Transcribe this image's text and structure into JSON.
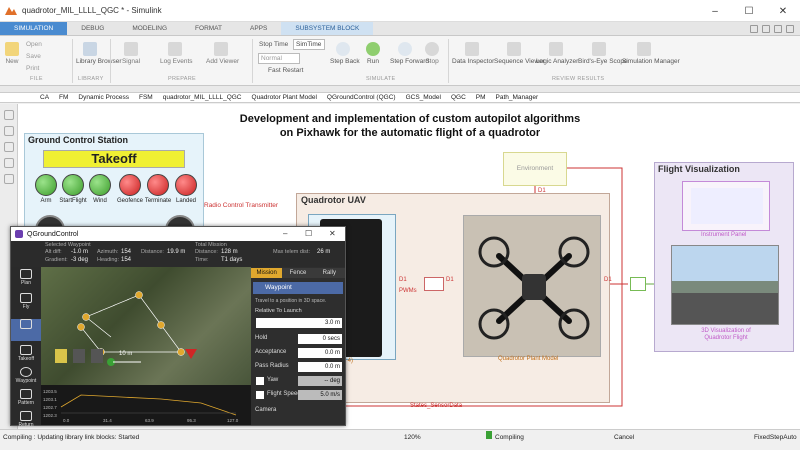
{
  "window": {
    "title": "quadrotor_MIL_LLLL_QGC * - Simulink"
  },
  "ribbon_tabs": [
    "SIMULATION",
    "DEBUG",
    "MODELING",
    "FORMAT",
    "APPS",
    "SUBSYSTEM BLOCK"
  ],
  "ribbon": {
    "file": {
      "open": "Open",
      "save": "Save",
      "print": "Print",
      "new": "New",
      "section": "FILE"
    },
    "library": {
      "label": "Library Browser",
      "section": "LIBRARY"
    },
    "prepare": {
      "signal": "Signal",
      "log": "Log Events",
      "add_viewer": "Add Viewer",
      "section": "PREPARE"
    },
    "simulate": {
      "stop_time_label": "Stop Time",
      "stop_time_value": "SimTime",
      "mode": "Normal",
      "fast_restart": "Fast Restart",
      "step_back": "Step Back",
      "run": "Run",
      "step_forward": "Step Forward",
      "stop": "Stop",
      "section": "SIMULATE"
    },
    "review": {
      "items": [
        "Data Inspector",
        "Sequence Viewer",
        "Logic Analyzer",
        "Bird's-Eye Scope",
        "Simulation Manager"
      ],
      "section": "REVIEW RESULTS"
    }
  },
  "breadcrumbs": [
    "CA",
    "FM",
    "Dynamic Process",
    "FSM",
    "quadrotor_MIL_LLLL_QGC",
    "Quadrotor Plant Model",
    "QGroundControl (QGC)",
    "GCS_Model",
    "QGC",
    "PM",
    "Path_Manager"
  ],
  "canvas": {
    "heading_line1": "Development and implementation of custom autopilot algorithms",
    "heading_line2": "on Pixhawk for the automatic flight of a quadrotor",
    "gcs": {
      "title": "Ground Control Station",
      "mode": "Takeoff",
      "lamps": [
        {
          "label": "Arm",
          "color": "#3c9d2b"
        },
        {
          "label": "StartFlight",
          "color": "#3c9d2b"
        },
        {
          "label": "Wind",
          "color": "#3c9d2b"
        },
        {
          "label": "Geofence",
          "color": "#c91f1f"
        },
        {
          "label": "Terminate",
          "color": "#c91f1f"
        },
        {
          "label": "Landed",
          "color": "#c91f1f"
        }
      ]
    },
    "radio_label": "Radio Control Transmitter",
    "uav": {
      "title": "Quadrotor UAV",
      "pixhawk_label": "ller (Pixhawk 4)",
      "plant_label": "Quadrotor Plant Model",
      "pwms": "PWMs",
      "d1": "D1"
    },
    "environment": "Environment",
    "states_label": "States_SensorData",
    "flight_viz": {
      "title": "Flight Visualization",
      "panel_label": "Instrument Panel",
      "vis_line1": "3D Visualization of",
      "vis_line2": "Quadrotor Flight"
    }
  },
  "qgc": {
    "title": "QGroundControl",
    "header": {
      "selected_waypoint": "Selected Waypoint",
      "alt_diff_label": "Alt diff:",
      "alt_diff_value": "-1.0 m",
      "azimuth_label": "Azimuth:",
      "azimuth_value": "154",
      "distance_label": "Distance:",
      "distance_value": "19.9 m",
      "gradient_label": "Gradient:",
      "gradient_value": "-3 deg",
      "heading_label": "Heading:",
      "heading_value": "154",
      "total_mission": "Total Mission",
      "tm_distance_label": "Distance:",
      "tm_distance_value": "128 m",
      "max_telem_label": "Max telem dist:",
      "max_telem_value": "26 m",
      "time_label": "Time:",
      "time_value": "T1 days"
    },
    "tools": [
      "Plan",
      "Fly",
      "Takeoff",
      "Waypoint",
      "Pattern",
      "Return"
    ],
    "map_scale": "10 m",
    "panel": {
      "tabs": [
        "Mission",
        "Fence",
        "Rally"
      ],
      "waypoint": "Waypoint",
      "desc": "Travel to a position in 3D space.",
      "altitude_mode": "Relative To Launch",
      "altitude_value": "3.0 m",
      "hold_label": "Hold",
      "hold_value": "0 secs",
      "acceptance_label": "Acceptance",
      "acceptance_value": "0.0 m",
      "pass_radius_label": "Pass Radius",
      "pass_radius_value": "0.0 m",
      "yaw_label": "Yaw",
      "yaw_value": "-- deg",
      "flight_speed_label": "Flight Speed",
      "flight_speed_value": "5.0 m/s",
      "camera_label": "Camera"
    },
    "plot_ticks": [
      "0.0",
      "31.4",
      "63.9",
      "95.3",
      "127.0"
    ],
    "plot_y": [
      "1203.5",
      "1203.1",
      "1202.7",
      "1202.3"
    ]
  },
  "status": {
    "message": "Compiling : Updating library link blocks: Started",
    "zoom": "120%",
    "state": "Compiling",
    "cancel": "Cancel",
    "solver": "FixedStepAuto"
  }
}
